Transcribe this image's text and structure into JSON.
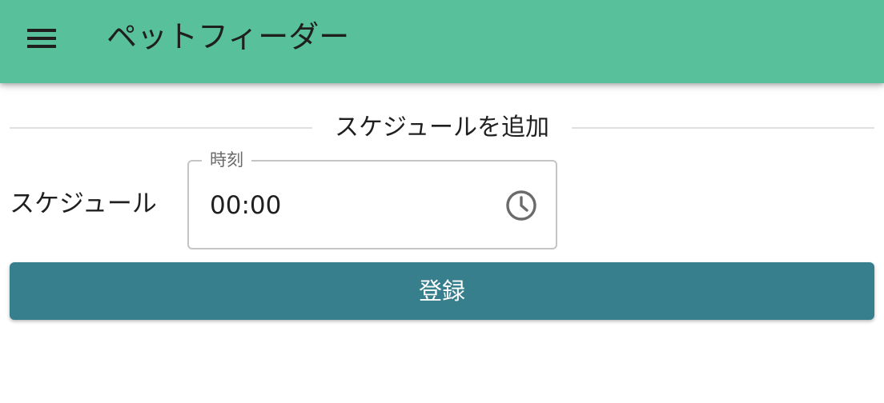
{
  "app_bar": {
    "title": "ペットフィーダー",
    "menu_icon": "hamburger-menu-icon",
    "background_color": "#58c19c"
  },
  "section": {
    "title": "スケジュールを追加"
  },
  "schedule_field": {
    "label": "スケジュール",
    "legend": "時刻",
    "value": "00:00",
    "icon": "clock-icon"
  },
  "submit": {
    "label": "登録",
    "background_color": "#377f8d"
  }
}
